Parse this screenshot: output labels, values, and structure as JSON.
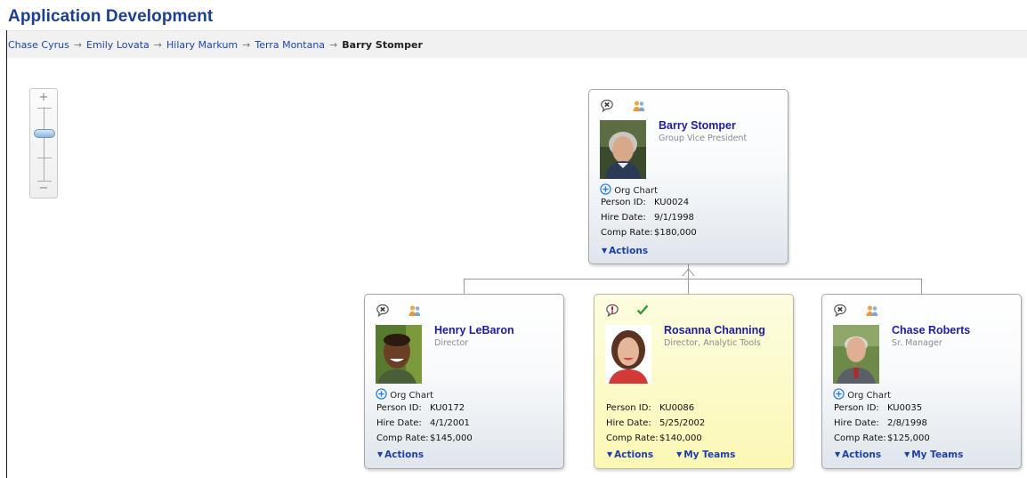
{
  "header": {
    "title": "Application Development"
  },
  "breadcrumb": {
    "links": [
      "Chase Cyrus",
      "Emily Lovata",
      "Hilary Markum",
      "Terra Montana"
    ],
    "separator": "→",
    "current": "Barry Stomper"
  },
  "zoom": {
    "plus": "+",
    "minus": "−",
    "level": 0.7
  },
  "field_labels": {
    "person_id": "Person ID:",
    "hire_date": "Hire Date:",
    "comp_rate": "Comp Rate:"
  },
  "labels": {
    "org_chart": "Org Chart",
    "actions": "Actions",
    "my_teams": "My Teams"
  },
  "colors": {
    "link": "#1d46a8",
    "name": "#1d1d9c",
    "highlight": "#fbf8b4"
  },
  "cards": {
    "root": {
      "name": "Barry Stomper",
      "title": "Group Vice President",
      "person_id": "KU0024",
      "hire_date": "9/1/1998",
      "comp_rate": "$180,000",
      "icons": [
        "comment-x-icon",
        "team-icon"
      ]
    },
    "c1": {
      "name": "Henry LeBaron",
      "title": "Director",
      "person_id": "KU0172",
      "hire_date": "4/1/2001",
      "comp_rate": "$145,000",
      "icons": [
        "comment-x-icon",
        "team-icon"
      ]
    },
    "c2": {
      "name": "Rosanna Channing",
      "title": "Director, Analytic Tools",
      "person_id": "KU0086",
      "hire_date": "5/25/2002",
      "comp_rate": "$140,000",
      "icons": [
        "comment-alert-icon",
        "check-icon"
      ]
    },
    "c3": {
      "name": "Chase Roberts",
      "title": "Sr. Manager",
      "person_id": "KU0035",
      "hire_date": "2/8/1998",
      "comp_rate": "$125,000",
      "icons": [
        "comment-x-icon",
        "team-icon"
      ]
    }
  }
}
